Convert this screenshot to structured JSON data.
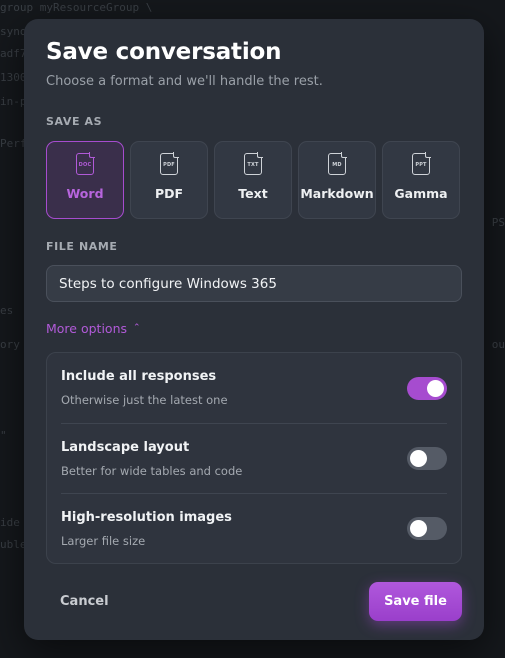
{
  "backdrop": {
    "lines": [
      "group myResourceGroup \\",
      "syno",
      "adf7",
      "1300",
      "in-p",
      "Perf"
    ],
    "mid_lines": [
      "es",
      "ory",
      "\"",
      "ide",
      "uble"
    ],
    "right_lines": [
      "PS",
      "ou"
    ]
  },
  "dialog": {
    "title": "Save conversation",
    "subtitle": "Choose a format and we'll handle the rest.",
    "save_as_label": "SAVE AS",
    "formats": [
      {
        "label": "Word",
        "tag": "DOC",
        "selected": true
      },
      {
        "label": "PDF",
        "tag": "PDF",
        "selected": false
      },
      {
        "label": "Text",
        "tag": "TXT",
        "selected": false
      },
      {
        "label": "Markdown",
        "tag": "MD",
        "selected": false
      },
      {
        "label": "Gamma",
        "tag": "PPT",
        "selected": false
      }
    ],
    "file_name_label": "FILE NAME",
    "file_name_value": "Steps to configure Windows 365",
    "more_options_label": "More options",
    "options": [
      {
        "title": "Include all responses",
        "desc": "Otherwise just the latest one",
        "enabled": true
      },
      {
        "title": "Landscape layout",
        "desc": "Better for wide tables and code",
        "enabled": false
      },
      {
        "title": "High-resolution images",
        "desc": "Larger file size",
        "enabled": false
      }
    ],
    "cancel_label": "Cancel",
    "save_label": "Save file"
  },
  "colors": {
    "accent": "#a64ccf",
    "dialog_bg": "#2b3039",
    "page_bg": "#15181c"
  }
}
